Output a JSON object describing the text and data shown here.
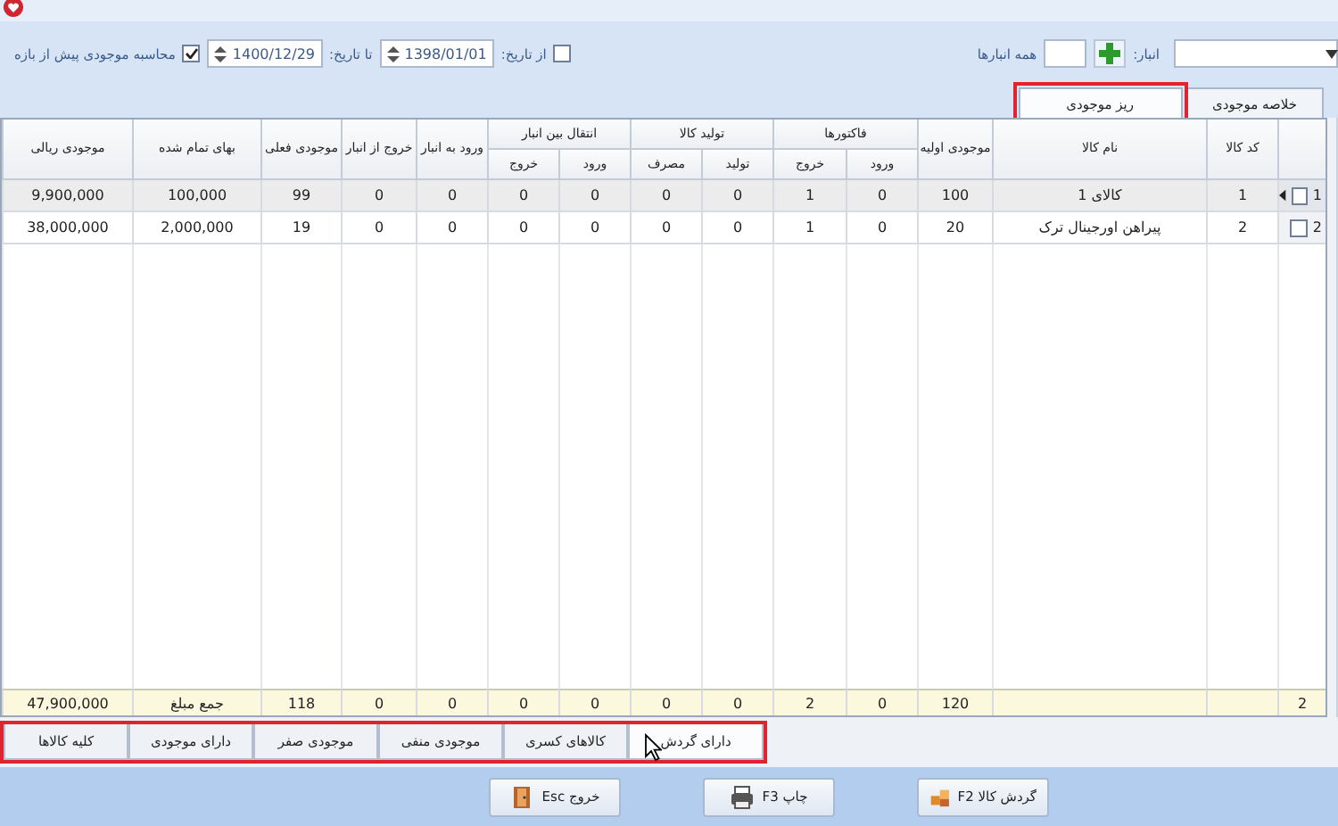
{
  "toolbar": {
    "warehouse_label": "انبار:",
    "all_warehouses_label": "همه انبارها",
    "from_date": {
      "checked": false,
      "label": "از تاریخ:",
      "value": "1398/01/01"
    },
    "to_date": {
      "label": "تا تاریخ:",
      "value": "1400/12/29"
    },
    "prior_balance": {
      "checked": true,
      "label": "محاسبه موجودی پیش از بازه"
    }
  },
  "tabs": [
    {
      "label": "خلاصه موجودی",
      "selected": false,
      "highlighted": false
    },
    {
      "label": "ریز موجودی",
      "selected": true,
      "highlighted": true
    }
  ],
  "table": {
    "columns": [
      {
        "label": "کد کالا"
      },
      {
        "label": "نام کالا"
      },
      {
        "label": "موجودی اولیه"
      },
      {
        "label": "ورود",
        "group_start": {
          "label": "فاکتورها"
        }
      },
      {
        "label": "خروج",
        "in_group": true
      },
      {
        "label": "تولید",
        "group_start": {
          "label": "تولید کالا"
        }
      },
      {
        "label": "مصرف",
        "in_group": true
      },
      {
        "label": "ورود",
        "group_start": {
          "label": "انتقال بین انبار"
        }
      },
      {
        "label": "خروج",
        "in_group": true
      },
      {
        "label": "ورود به انبار"
      },
      {
        "label": "خروج از انبار"
      },
      {
        "label": "موجودی فعلی"
      },
      {
        "label": "بهای تمام شده"
      },
      {
        "label": "موجودی ریالی"
      }
    ],
    "rows": [
      {
        "number": "1",
        "selected": true,
        "current": true,
        "checked": false,
        "cells": [
          "1",
          "کالای 1",
          "100",
          "0",
          "1",
          "0",
          "0",
          "0",
          "0",
          "0",
          "0",
          "99",
          "100,000",
          "9,900,000"
        ]
      },
      {
        "number": "2",
        "selected": false,
        "current": false,
        "checked": false,
        "cells": [
          "2",
          "پیراهن اورجینال ترک",
          "20",
          "0",
          "1",
          "0",
          "0",
          "0",
          "0",
          "0",
          "0",
          "19",
          "2,000,000",
          "38,000,000"
        ]
      }
    ],
    "totals": {
      "count": "2",
      "cells": [
        null,
        null,
        "120",
        "0",
        "2",
        "0",
        "0",
        "0",
        "0",
        "0",
        "0",
        "118",
        "جمع مبلغ",
        "47,900,000"
      ]
    }
  },
  "bottom_tabs": {
    "highlighted": true,
    "items": [
      {
        "label": "دارای گردش",
        "selected": true
      },
      {
        "label": "کالاهای کسری",
        "selected": false
      },
      {
        "label": "موجودی منفی",
        "selected": false
      },
      {
        "label": "موجودی صفر",
        "selected": false
      },
      {
        "label": "دارای موجودی",
        "selected": false
      },
      {
        "label": "کلیه کالاها",
        "selected": false
      }
    ]
  },
  "buttons": [
    {
      "kind": "turnover",
      "label": "گردش کالا F2"
    },
    {
      "kind": "print",
      "label": "چاپ F3"
    },
    {
      "kind": "exit",
      "label": "خروج Esc"
    }
  ]
}
